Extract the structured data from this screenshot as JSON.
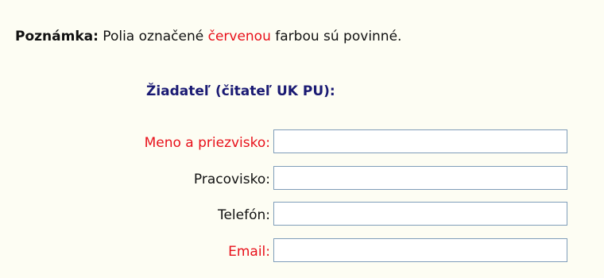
{
  "note": {
    "prefix": "Poznámka:",
    "text_before": " Polia označené ",
    "highlight": "červenou",
    "text_after": " farbou sú povinné."
  },
  "section_title": "Žiadateľ (čitateľ UK PU):",
  "fields": [
    {
      "label": "Meno a priezvisko:",
      "required": true,
      "value": ""
    },
    {
      "label": "Pracovisko:",
      "required": false,
      "value": ""
    },
    {
      "label": "Telefón:",
      "required": false,
      "value": ""
    },
    {
      "label": "Email:",
      "required": true,
      "value": ""
    }
  ],
  "colors": {
    "required": "#e8101a",
    "heading": "#1a1a73",
    "background": "#fdfdf3",
    "input_border": "#7f9db9"
  }
}
